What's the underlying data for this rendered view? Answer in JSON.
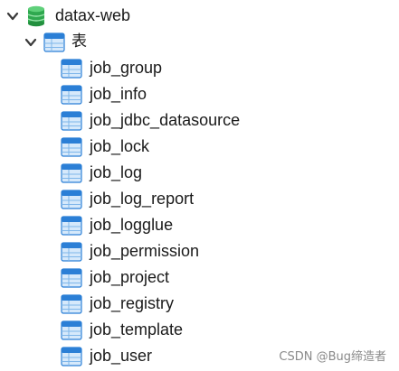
{
  "tree": {
    "connection": {
      "label": "datax-web",
      "icon": "database-icon",
      "expanded": true
    },
    "group": {
      "label": "表",
      "icon": "table-group-icon",
      "expanded": true
    },
    "tables": [
      {
        "label": "job_group",
        "icon": "table-icon"
      },
      {
        "label": "job_info",
        "icon": "table-icon"
      },
      {
        "label": "job_jdbc_datasource",
        "icon": "table-icon"
      },
      {
        "label": "job_lock",
        "icon": "table-icon"
      },
      {
        "label": "job_log",
        "icon": "table-icon"
      },
      {
        "label": "job_log_report",
        "icon": "table-icon"
      },
      {
        "label": "job_logglue",
        "icon": "table-icon"
      },
      {
        "label": "job_permission",
        "icon": "table-icon"
      },
      {
        "label": "job_project",
        "icon": "table-icon"
      },
      {
        "label": "job_registry",
        "icon": "table-icon"
      },
      {
        "label": "job_template",
        "icon": "table-icon"
      },
      {
        "label": "job_user",
        "icon": "table-icon"
      }
    ]
  },
  "watermark": "CSDN @Bug缔造者",
  "colors": {
    "database_green": "#2fa84f",
    "table_blue": "#2b7fd6",
    "table_light": "#d6e9fb",
    "chevron": "#3a3a3a"
  }
}
